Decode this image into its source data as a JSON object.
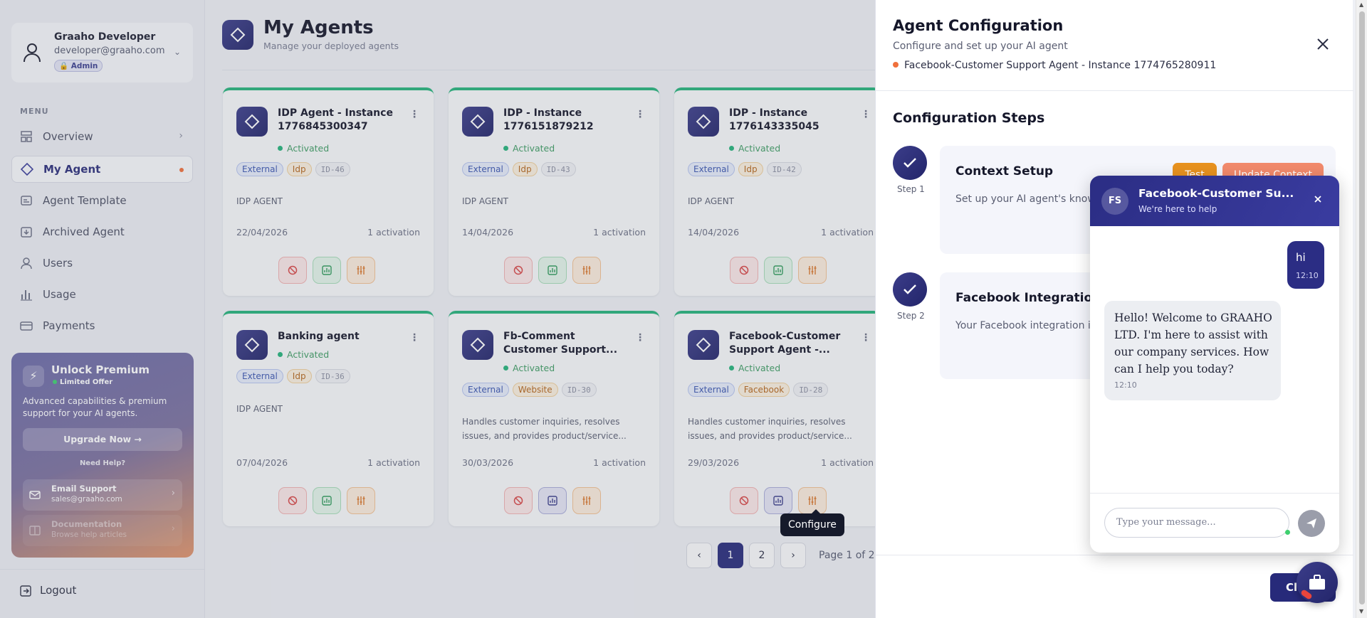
{
  "user": {
    "name": "Graaho Developer",
    "email": "developer@graaho.com",
    "role": "Admin"
  },
  "menu": {
    "label": "MENU",
    "items": [
      {
        "label": "Overview",
        "icon": "grid-icon"
      },
      {
        "label": "My Agent",
        "icon": "diamond-icon"
      },
      {
        "label": "Agent Template",
        "icon": "template-icon"
      },
      {
        "label": "Archived Agent",
        "icon": "archive-icon"
      },
      {
        "label": "Users",
        "icon": "user-icon"
      },
      {
        "label": "Usage",
        "icon": "bar-chart-icon"
      },
      {
        "label": "Payments",
        "icon": "card-icon"
      }
    ]
  },
  "premium": {
    "title": "Unlock Premium",
    "badge": "Limited Offer",
    "desc": "Advanced capabilities & premium support for your AI agents.",
    "button": "Upgrade Now →",
    "help_label": "Need Help?",
    "email_title": "Email Support",
    "email_sub": "sales@graaho.com",
    "doc_title": "Documentation",
    "doc_sub": "Browse help articles"
  },
  "logout": "Logout",
  "page": {
    "title": "My Agents",
    "subtitle": "Manage your deployed agents"
  },
  "cards": [
    {
      "name": "IDP Agent - Instance 1776845300347",
      "status": "Activated",
      "tags": [
        "External",
        "Idp",
        "ID-46"
      ],
      "desc": "IDP AGENT",
      "date": "22/04/2026",
      "activations": "1 activation"
    },
    {
      "name": "IDP - Instance 1776151879212",
      "status": "Activated",
      "tags": [
        "External",
        "Idp",
        "ID-43"
      ],
      "desc": "IDP AGENT",
      "date": "14/04/2026",
      "activations": "1 activation"
    },
    {
      "name": "IDP - Instance 1776143335045",
      "status": "Activated",
      "tags": [
        "External",
        "Idp",
        "ID-42"
      ],
      "desc": "IDP AGENT",
      "date": "14/04/2026",
      "activations": "1 activation"
    },
    {
      "name": "Banking agent",
      "status": "Activated",
      "tags": [
        "External",
        "Idp",
        "ID-36"
      ],
      "desc": "IDP AGENT",
      "date": "07/04/2026",
      "activations": "1 activation"
    },
    {
      "name": "Fb-Comment Customer Support...",
      "status": "Activated",
      "tags": [
        "External",
        "Website",
        "ID-30"
      ],
      "desc": "Handles customer inquiries, resolves issues, and provides product/service...",
      "date": "30/03/2026",
      "activations": "1 activation"
    },
    {
      "name": "Facebook-Customer Support Agent -...",
      "status": "Activated",
      "tags": [
        "External",
        "Facebook",
        "ID-28"
      ],
      "desc": "Handles customer inquiries, resolves issues, and provides product/service...",
      "date": "29/03/2026",
      "activations": "1 activation"
    }
  ],
  "pagination": {
    "pages": [
      "1",
      "2"
    ],
    "current": "1",
    "info": "Page 1 of 2"
  },
  "tooltip": "Configure",
  "panel": {
    "title": "Agent Configuration",
    "subtitle": "Configure and set up your AI agent",
    "agent": "Facebook-Customer Support Agent - Instance 1774765280911",
    "steps_title": "Configuration Steps",
    "steps": [
      {
        "label": "Step 1",
        "title": "Context Setup",
        "desc": "Set up your AI agent's know users receive accurate and",
        "test": "Test",
        "update": "Update Context"
      },
      {
        "label": "Step 2",
        "title": "Facebook Integration",
        "desc": "Your Facebook integration i settings."
      }
    ],
    "close_label": "Cl"
  },
  "chat": {
    "initials": "FS",
    "title": "Facebook-Customer Su...",
    "subtitle": "We're here to help",
    "messages": [
      {
        "from": "user",
        "text": "hi",
        "time": "12:10"
      },
      {
        "from": "bot",
        "text": "Hello! Welcome to GRAAHO LTD. I'm here to assist with our company services. How can I help you today?",
        "time": "12:10"
      }
    ],
    "placeholder": "Type your message..."
  },
  "colors": {
    "primary": "#272a7a",
    "accent": "#f0703c",
    "success": "#24b37a"
  }
}
